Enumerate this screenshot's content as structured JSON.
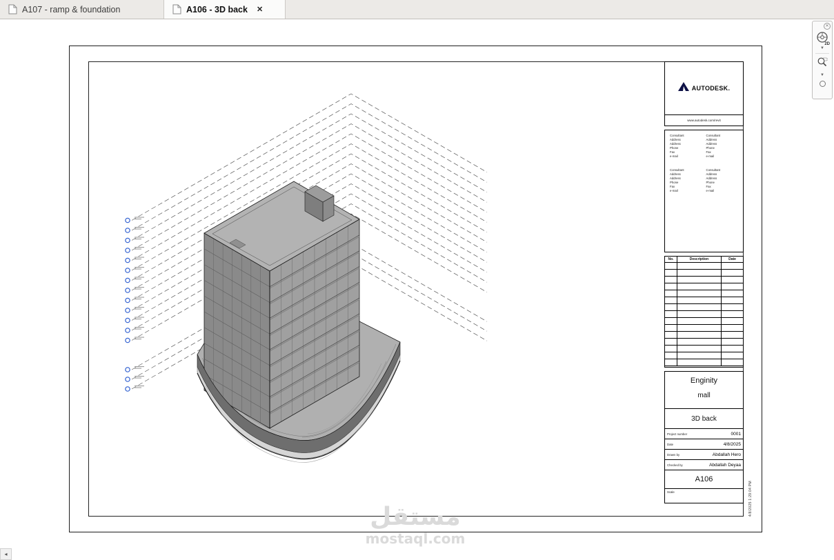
{
  "tabs": [
    {
      "label": "A107 - ramp & foundation",
      "active": false
    },
    {
      "label": "A106 - 3D back",
      "active": true,
      "close": "✕"
    }
  ],
  "navbar": {
    "wheel_label": "2D"
  },
  "watermark": {
    "arabic": "مستقل",
    "latin": "mostaql.com"
  },
  "sheet": {
    "print_stamp": "4/8/2025 1:29:04 PM",
    "titleblock": {
      "logo_text": "AUTODESK.",
      "url": "www.autodesk.com/revit",
      "consultant_block": [
        "Consultant",
        "Address",
        "Address",
        "Phone",
        "Fax",
        "e-mail"
      ],
      "consultant_count": 4,
      "revision_headers": [
        "No.",
        "Description",
        "Date"
      ],
      "revision_rows": 15,
      "project_line1": "Enginity",
      "project_line2": "mall",
      "sheet_title": "3D back",
      "fields": [
        {
          "label": "Project number",
          "value": "0001"
        },
        {
          "label": "Date",
          "value": "4/8/2025"
        },
        {
          "label": "Drawn by",
          "value": "Abdallah Hero"
        },
        {
          "label": "Checked by",
          "value": "Abdallah Deyaa"
        }
      ],
      "sheet_number": "A106",
      "scale_label": "Scale",
      "scale_value": ""
    },
    "levels": {
      "upper_count": 13,
      "lower_count": 3,
      "marker_color": "#2f5fd0",
      "line_color": "#555555"
    }
  }
}
